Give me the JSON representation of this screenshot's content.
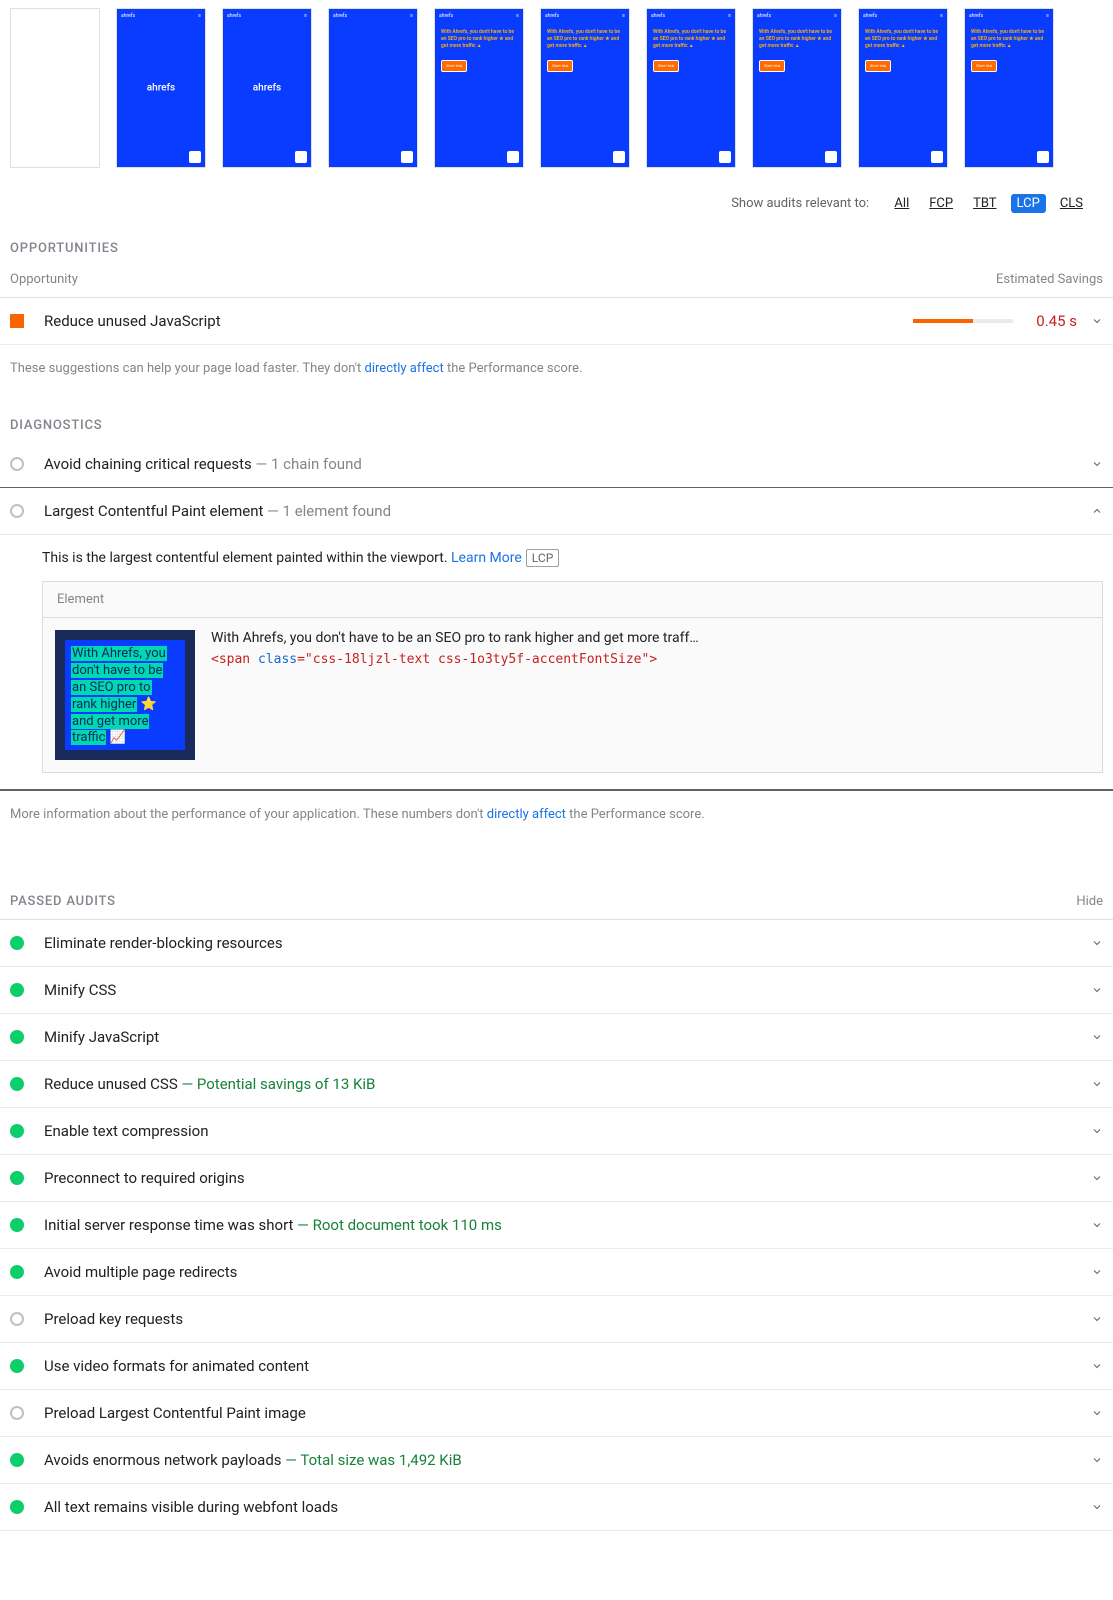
{
  "filmstrip": {
    "frames": [
      {
        "type": "blank"
      },
      {
        "type": "logo",
        "logo": "ahrefs"
      },
      {
        "type": "logo",
        "logo": "ahrefs"
      },
      {
        "type": "logo-only",
        "logo": ""
      },
      {
        "type": "full",
        "headline": "With Ahrefs, you don't have to be an SEO pro to rank higher ★ and get more traffic ▲",
        "cta": "Start trial"
      },
      {
        "type": "full",
        "headline": "With Ahrefs, you don't have to be an SEO pro to rank higher ★ and get more traffic ▲",
        "cta": "Start trial"
      },
      {
        "type": "full",
        "headline": "With Ahrefs, you don't have to be an SEO pro to rank higher ★ and get more traffic ▲",
        "cta": "Start trial"
      },
      {
        "type": "full",
        "headline": "With Ahrefs, you don't have to be an SEO pro to rank higher ★ and get more traffic ▲",
        "cta": "Start trial"
      },
      {
        "type": "full",
        "headline": "With Ahrefs, you don't have to be an SEO pro to rank higher ★ and get more traffic ▲",
        "cta": "Start trial"
      },
      {
        "type": "full",
        "headline": "With Ahrefs, you don't have to be an SEO pro to rank higher ★ and get more traffic ▲",
        "cta": "Start trial"
      }
    ]
  },
  "filter": {
    "label": "Show audits relevant to:",
    "options": [
      "All",
      "FCP",
      "TBT",
      "LCP",
      "CLS"
    ],
    "active": "LCP"
  },
  "opportunities": {
    "title": "OPPORTUNITIES",
    "col_left": "Opportunity",
    "col_right": "Estimated Savings",
    "items": [
      {
        "indicator": "square",
        "title": "Reduce unused JavaScript",
        "savings_text": "0.45 s",
        "savings_pct": 60
      }
    ],
    "note_pre": "These suggestions can help your page load faster. They don't ",
    "note_link": "directly affect",
    "note_post": " the Performance score."
  },
  "diagnostics": {
    "title": "DIAGNOSTICS",
    "items": [
      {
        "indicator": "gray-circle",
        "title": "Avoid chaining critical requests",
        "suffix": " — 1 chain found",
        "expanded": false
      },
      {
        "indicator": "gray-circle",
        "title": "Largest Contentful Paint element",
        "suffix": " — 1 element found",
        "expanded": true
      }
    ],
    "expanded": {
      "desc": "This is the largest contentful element painted within the viewport. ",
      "learn_more": "Learn More",
      "tag": "LCP",
      "element_header": "Element",
      "thumb_text": "With Ahrefs, you don't have to be an SEO pro to rank higher ⭐ and get more traffic 📈",
      "text_line": "With Ahrefs, you don't have to be an SEO pro to rank higher and get more traff…",
      "code_line": "<span class=\"css-18ljzl-text css-1o3ty5f-accentFontSize\">"
    },
    "note_pre": "More information about the performance of your application. These numbers don't ",
    "note_link": "directly affect",
    "note_post": " the Performance score."
  },
  "passed": {
    "title": "PASSED AUDITS",
    "hide": "Hide",
    "items": [
      {
        "indicator": "green-dot",
        "title": "Eliminate render-blocking resources",
        "suffix": ""
      },
      {
        "indicator": "green-dot",
        "title": "Minify CSS",
        "suffix": ""
      },
      {
        "indicator": "green-dot",
        "title": "Minify JavaScript",
        "suffix": ""
      },
      {
        "indicator": "green-dot",
        "title": "Reduce unused CSS",
        "suffix": " — Potential savings of 13 KiB",
        "green": true
      },
      {
        "indicator": "green-dot",
        "title": "Enable text compression",
        "suffix": ""
      },
      {
        "indicator": "green-dot",
        "title": "Preconnect to required origins",
        "suffix": ""
      },
      {
        "indicator": "green-dot",
        "title": "Initial server response time was short",
        "suffix": " — Root document took 110 ms",
        "green": true
      },
      {
        "indicator": "green-dot",
        "title": "Avoid multiple page redirects",
        "suffix": ""
      },
      {
        "indicator": "gray-circle",
        "title": "Preload key requests",
        "suffix": ""
      },
      {
        "indicator": "green-dot",
        "title": "Use video formats for animated content",
        "suffix": ""
      },
      {
        "indicator": "gray-circle",
        "title": "Preload Largest Contentful Paint image",
        "suffix": ""
      },
      {
        "indicator": "green-dot",
        "title": "Avoids enormous network payloads",
        "suffix": " — Total size was 1,492 KiB",
        "green": true
      },
      {
        "indicator": "green-dot",
        "title": "All text remains visible during webfont loads",
        "suffix": ""
      }
    ]
  }
}
